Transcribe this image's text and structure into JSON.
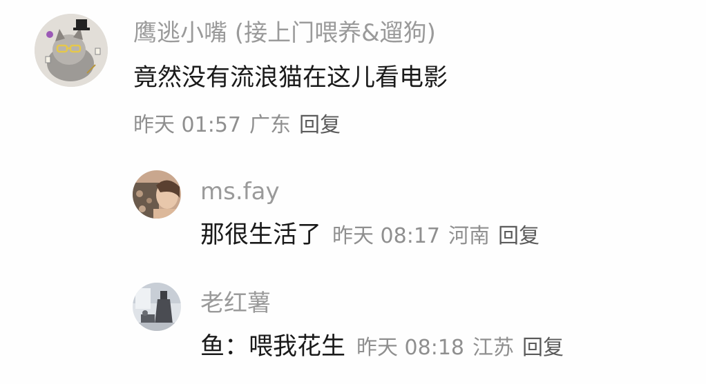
{
  "comments": [
    {
      "username": "鹰逃小嘴 (接上门喂养&遛狗)",
      "text": "竟然没有流浪猫在这儿看电影",
      "time": "昨天 01:57",
      "location": "广东",
      "reply_label": "回复",
      "replies": [
        {
          "username": "ms.fay",
          "text": "那很生活了",
          "time": "昨天 08:17",
          "location": "河南",
          "reply_label": "回复"
        },
        {
          "username": "老红薯",
          "text": "鱼：喂我花生",
          "time": "昨天 08:18",
          "location": "江苏",
          "reply_label": "回复"
        }
      ]
    }
  ]
}
